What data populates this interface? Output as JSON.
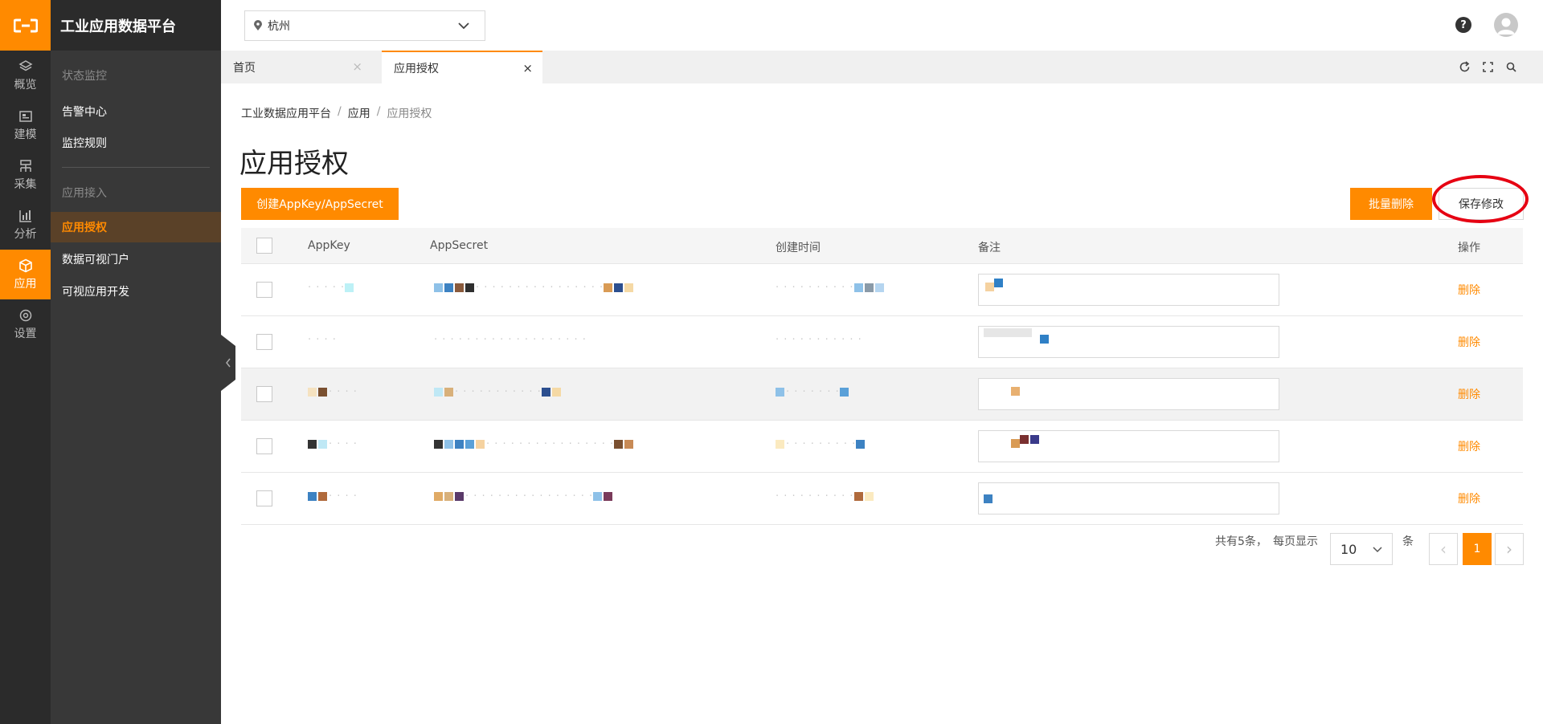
{
  "brand": {
    "title": "工业应用数据平台",
    "accent": "#ff8a00"
  },
  "rail": [
    {
      "icon": "layers-icon",
      "label": "概览"
    },
    {
      "icon": "model-icon",
      "label": "建模"
    },
    {
      "icon": "collect-icon",
      "label": "采集"
    },
    {
      "icon": "chart-icon",
      "label": "分析"
    },
    {
      "icon": "cube-icon",
      "label": "应用",
      "active": true
    },
    {
      "icon": "gear-icon",
      "label": "设置"
    }
  ],
  "sidebar": {
    "group1": "状态监控",
    "alarm_center": "告警中心",
    "monitor_rules": "监控规则",
    "group2": "应用接入",
    "app_auth": "应用授权",
    "data_portal": "数据可视门户",
    "visual_dev": "可视应用开发"
  },
  "header": {
    "city": "杭州",
    "help": "?"
  },
  "tabs": [
    {
      "label": "首页"
    },
    {
      "label": "应用授权",
      "active": true
    }
  ],
  "breadcrumb": {
    "root": "工业数据应用平台",
    "mid": "应用",
    "current": "应用授权",
    "sep": "/"
  },
  "page": {
    "title": "应用授权",
    "create_button": "创建AppKey/AppSecret",
    "batch_delete_button": "批量删除",
    "save_button": "保存修改"
  },
  "table": {
    "columns": [
      "AppKey",
      "AppSecret",
      "创建时间",
      "备注",
      "操作"
    ],
    "delete_label": "删除",
    "rows": [
      {
        "appkey": "· · ·  ·  ·",
        "secret": "· · · · · · · · · · · · · · · ·",
        "time": "· · · · · · · · · ·",
        "note": ""
      },
      {
        "appkey": "·  ·  ·  ·",
        "secret": "· · · · · · · · · · · · · · · · · · ·",
        "time": "· · · · · · · · · · ·",
        "note": ""
      },
      {
        "appkey": "· · ·  ·",
        "secret": "·  ·  ·  ·  ·  ·  ·  ·  ·  ·  ·",
        "time": "·  ·  ·  ·  ·  ·  ·",
        "note": ""
      },
      {
        "appkey": "· ·  ·  ·",
        "secret": "· · · · · · · · · · · · · · · ·",
        "time": "· · · · · · · · ·",
        "note": ""
      },
      {
        "appkey": "· · ·  ·",
        "secret": "· · · · · · · · · · · · · · · ·",
        "time": "· · · · · · · · · ·",
        "note": ""
      }
    ]
  },
  "pagination": {
    "total_text": "共有5条，",
    "per_page_text": "每页显示",
    "page_size": "10",
    "unit": "条",
    "current_page": "1",
    "prev": "‹",
    "next": "›"
  }
}
